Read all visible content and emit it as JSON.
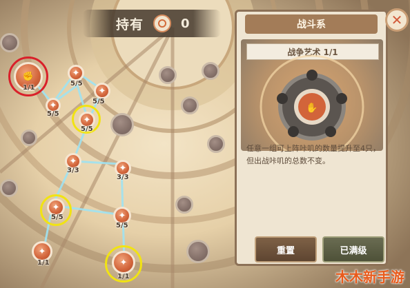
{
  "holding": {
    "label": "持有",
    "count": "0",
    "icon": "coin-icon"
  },
  "panel": {
    "header": "战斗系",
    "skill_title": "战争艺术 1/1",
    "description": "任意一组可上阵咔叽的数量提升至4只，但出战咔叽的总数不变。",
    "reset_button": "重置",
    "maxed_button": "已满级"
  },
  "close_icon": "close-icon",
  "nodes": [
    {
      "name": "node-top-left-selected",
      "level": "1/1"
    },
    {
      "name": "node-a",
      "level": "5/5"
    },
    {
      "name": "node-b",
      "level": "5/5"
    },
    {
      "name": "node-c-highlight",
      "level": "5/5"
    },
    {
      "name": "node-d",
      "level": "3/3"
    },
    {
      "name": "node-e",
      "level": "3/3"
    },
    {
      "name": "node-f-highlight",
      "level": "5/5"
    },
    {
      "name": "node-g",
      "level": "5/5"
    },
    {
      "name": "node-h",
      "level": "1/1"
    },
    {
      "name": "node-i-highlight",
      "level": "1/1"
    },
    {
      "name": "node-top",
      "level": "5/5"
    }
  ],
  "watermark": "木木新手游",
  "colors": {
    "highlight_yellow": "#f1e313",
    "selected_red": "#d9202a",
    "path_blue": "#9fe3f2",
    "accent_orange": "#d2643a"
  }
}
